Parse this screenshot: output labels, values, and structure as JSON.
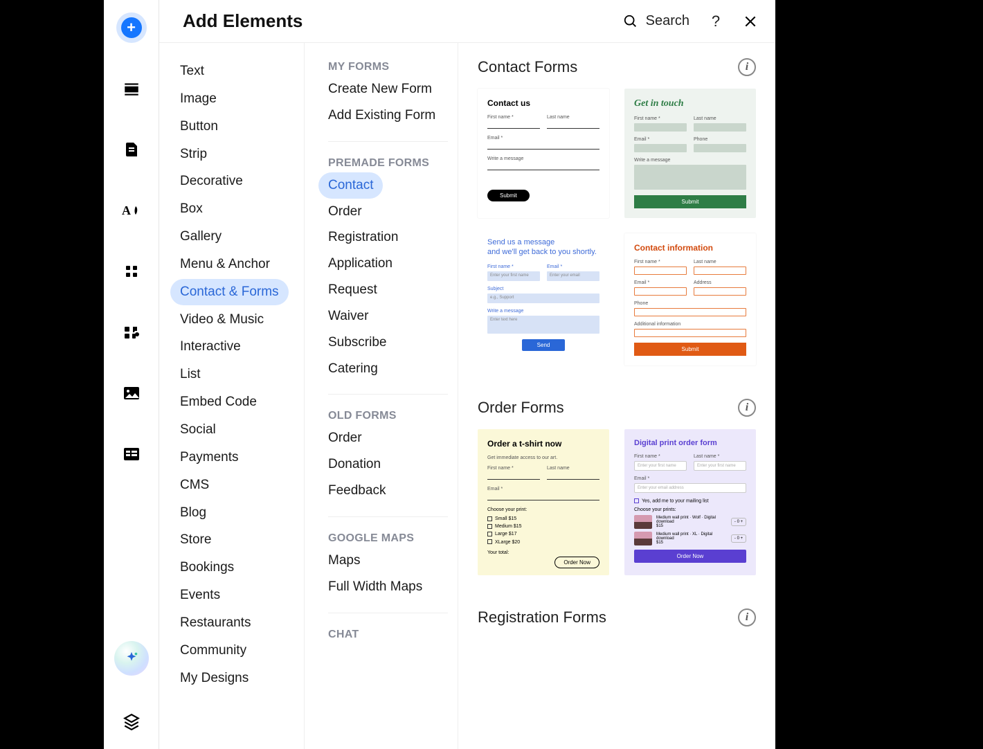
{
  "header": {
    "title": "Add Elements",
    "search_label": "Search"
  },
  "categories": [
    {
      "label": "Text",
      "active": false
    },
    {
      "label": "Image",
      "active": false
    },
    {
      "label": "Button",
      "active": false
    },
    {
      "label": "Strip",
      "active": false
    },
    {
      "label": "Decorative",
      "active": false
    },
    {
      "label": "Box",
      "active": false
    },
    {
      "label": "Gallery",
      "active": false
    },
    {
      "label": "Menu & Anchor",
      "active": false
    },
    {
      "label": "Contact & Forms",
      "active": true
    },
    {
      "label": "Video & Music",
      "active": false
    },
    {
      "label": "Interactive",
      "active": false
    },
    {
      "label": "List",
      "active": false
    },
    {
      "label": "Embed Code",
      "active": false
    },
    {
      "label": "Social",
      "active": false
    },
    {
      "label": "Payments",
      "active": false
    },
    {
      "label": "CMS",
      "active": false
    },
    {
      "label": "Blog",
      "active": false
    },
    {
      "label": "Store",
      "active": false
    },
    {
      "label": "Bookings",
      "active": false
    },
    {
      "label": "Events",
      "active": false
    },
    {
      "label": "Restaurants",
      "active": false
    },
    {
      "label": "Community",
      "active": false
    },
    {
      "label": "My Designs",
      "active": false
    }
  ],
  "form_groups": [
    {
      "label": "MY FORMS",
      "items": [
        {
          "label": "Create New Form",
          "active": false
        },
        {
          "label": "Add Existing Form",
          "active": false
        }
      ]
    },
    {
      "label": "PREMADE FORMS",
      "items": [
        {
          "label": "Contact",
          "active": true
        },
        {
          "label": "Order",
          "active": false
        },
        {
          "label": "Registration",
          "active": false
        },
        {
          "label": "Application",
          "active": false
        },
        {
          "label": "Request",
          "active": false
        },
        {
          "label": "Waiver",
          "active": false
        },
        {
          "label": "Subscribe",
          "active": false
        },
        {
          "label": "Catering",
          "active": false
        }
      ]
    },
    {
      "label": "OLD FORMS",
      "items": [
        {
          "label": "Order",
          "active": false
        },
        {
          "label": "Donation",
          "active": false
        },
        {
          "label": "Feedback",
          "active": false
        }
      ]
    },
    {
      "label": "GOOGLE MAPS",
      "items": [
        {
          "label": "Maps",
          "active": false
        },
        {
          "label": "Full Width Maps",
          "active": false
        }
      ]
    },
    {
      "label": "CHAT",
      "items": []
    }
  ],
  "sections": {
    "contact": {
      "title": "Contact Forms",
      "cards": {
        "a": {
          "title": "Contact us",
          "f1": "First name *",
          "f2": "Last name",
          "f3": "Email *",
          "f4": "Write a message",
          "btn": "Submit"
        },
        "b": {
          "title": "Get in touch",
          "f1": "First name *",
          "f2": "Last name",
          "f3": "Email *",
          "f4": "Phone",
          "f5": "Write a message",
          "btn": "Submit"
        },
        "c": {
          "heading1": "Send us a message",
          "heading2": "and we'll get back to you shortly.",
          "f1": "First name *",
          "f2": "Email *",
          "ph1": "Enter your first name",
          "ph2": "Enter your email",
          "f3": "Subject",
          "ph3": "e.g., Support",
          "f4": "Write a message",
          "ph4": "Enter text here",
          "btn": "Send"
        },
        "d": {
          "title": "Contact information",
          "f1": "First name *",
          "f2": "Last name",
          "f3": "Email *",
          "f4": "Address",
          "f5": "Phone",
          "f6": "Additional information",
          "btn": "Submit"
        }
      }
    },
    "order": {
      "title": "Order Forms",
      "cards": {
        "a": {
          "title": "Order a t-shirt now",
          "sub": "Get immediate access to our art.",
          "f1": "First name *",
          "f2": "Last name",
          "f3": "Email *",
          "pick": "Choose your print:",
          "o1": "Small $15",
          "o2": "Medium $15",
          "o3": "Large $17",
          "o4": "XLarge $20",
          "footer": "Your total:",
          "btn": "Order Now"
        },
        "b": {
          "title": "Digital print order form",
          "f1": "First name *",
          "f2": "Last name *",
          "ph": "Enter your first name",
          "f3": "Email *",
          "ph2": "Enter your email address",
          "cb": "Yes, add me to your mailing list",
          "pick": "Choose your prints:",
          "p1": "Medium wall print · Wolf · Digital download",
          "price1": "$15",
          "p2": "Medium wall print · XL · Digital download",
          "price2": "$15",
          "btn": "Order Now"
        }
      }
    },
    "registration": {
      "title": "Registration Forms"
    }
  }
}
